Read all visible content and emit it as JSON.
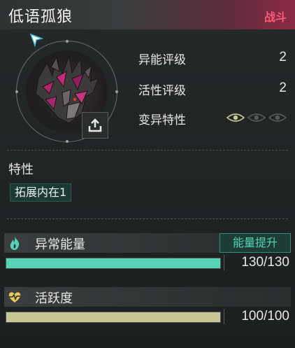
{
  "header": {
    "name": "低语孤狼",
    "tag": "战斗"
  },
  "stats": [
    {
      "label": "异能评级",
      "value": "2"
    },
    {
      "label": "活性评级",
      "value": "2"
    },
    {
      "label": "变异特性",
      "eyes": {
        "active": 1,
        "total": 3
      }
    }
  ],
  "traits": {
    "title": "特性",
    "badge": "拓展内在1"
  },
  "energy": {
    "label": "异常能量",
    "button": "能量提升",
    "current": 130,
    "max": 130,
    "text": "130/130",
    "fill": 1.0,
    "color": "#57d3b9"
  },
  "vitality": {
    "label": "活跃度",
    "current": 100,
    "max": 100,
    "text": "100/100",
    "fill": 1.0,
    "color": "#c9c795"
  },
  "colors": {
    "accent": "#57d3b9",
    "tag": "#ff5a7a",
    "eye_active": "#c9c795",
    "eye_inactive": "#55595a"
  }
}
